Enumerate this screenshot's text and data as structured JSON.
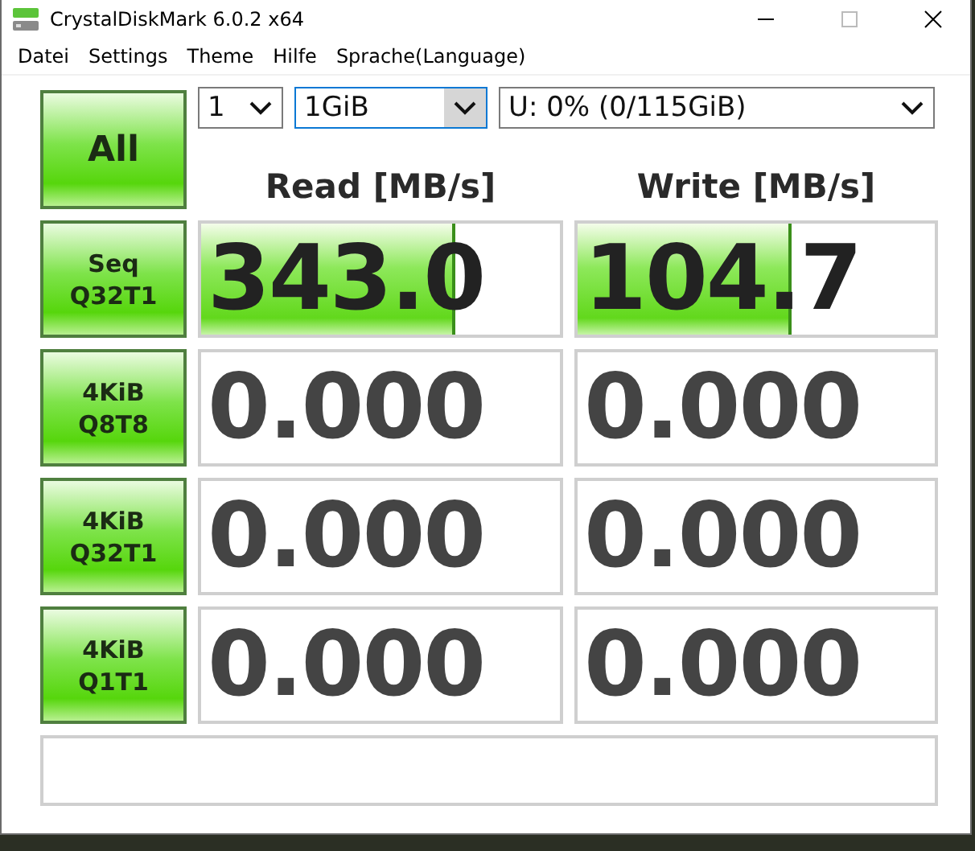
{
  "window": {
    "title": "CrystalDiskMark 6.0.2 x64"
  },
  "menu": [
    "Datei",
    "Settings",
    "Theme",
    "Hilfe",
    "Sprache(Language)"
  ],
  "all_button": "All",
  "selectors": [
    {
      "value": "1",
      "focused": false
    },
    {
      "value": "1GiB",
      "focused": true
    },
    {
      "value": "U: 0% (0/115GiB)",
      "focused": false
    }
  ],
  "headers": [
    "Read [MB/s]",
    "Write [MB/s]"
  ],
  "rows": [
    {
      "test": [
        "Seq",
        "Q32T1"
      ],
      "read": {
        "value": "343.0",
        "level": 0.7
      },
      "write": {
        "value": "104.7",
        "level": 0.59
      }
    },
    {
      "test": [
        "4KiB",
        "Q8T8"
      ],
      "read": {
        "value": "0.000"
      },
      "write": {
        "value": "0.000"
      }
    },
    {
      "test": [
        "4KiB",
        "Q32T1"
      ],
      "read": {
        "value": "0.000"
      },
      "write": {
        "value": "0.000"
      }
    },
    {
      "test": [
        "4KiB",
        "Q1T1"
      ],
      "read": {
        "value": "0.000"
      },
      "write": {
        "value": "0.000"
      }
    }
  ]
}
